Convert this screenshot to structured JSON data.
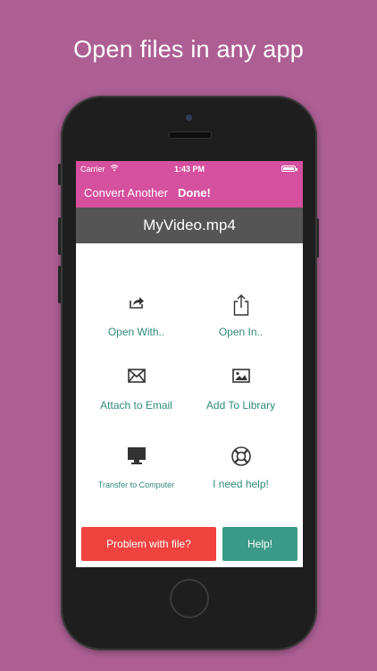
{
  "headline": "Open files in any app",
  "status_bar": {
    "carrier": "Carrier",
    "time": "1:43 PM"
  },
  "nav": {
    "convert_another": "Convert Another",
    "done": "Done!"
  },
  "file_name": "MyVideo.mp4",
  "actions": [
    {
      "label": "Open With..",
      "icon": "share-arrow-icon"
    },
    {
      "label": "Open In..",
      "icon": "share-box-icon"
    },
    {
      "label": "Attach to Email",
      "icon": "envelope-icon"
    },
    {
      "label": "Add To Library",
      "icon": "picture-icon"
    },
    {
      "label": "Transfer to Computer",
      "icon": "monitor-icon"
    },
    {
      "label": "I need help!",
      "icon": "lifebuoy-icon"
    }
  ],
  "buttons": {
    "problem": "Problem with file?",
    "help": "Help!"
  },
  "colors": {
    "background": "#ad5f94",
    "nav_pink": "#d5509e",
    "title_gray": "#555555",
    "action_teal": "#2e8a7c",
    "problem_red": "#f0423f",
    "help_green": "#3b9a87"
  }
}
